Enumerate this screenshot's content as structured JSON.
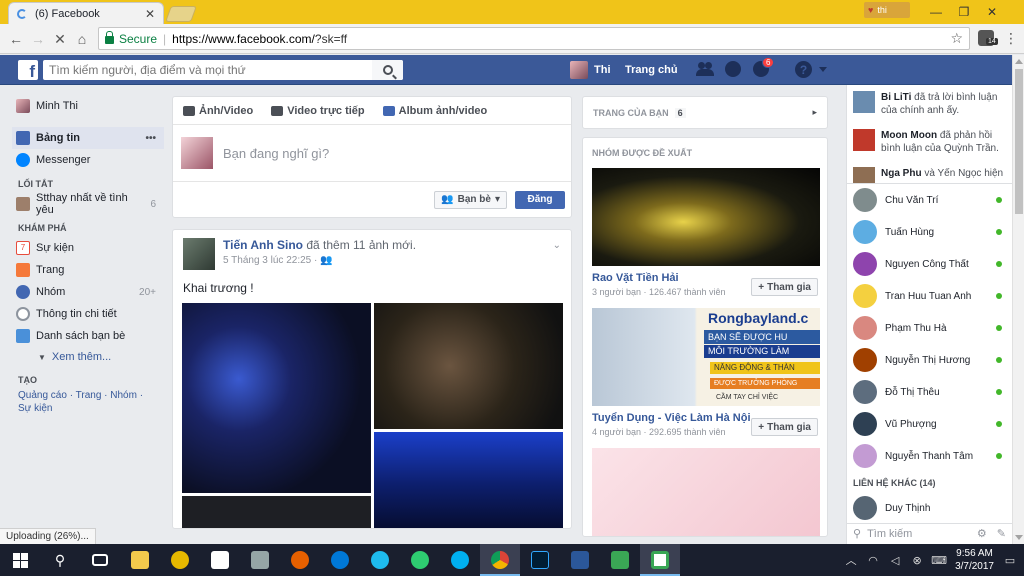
{
  "browser": {
    "tab_title": "(6) Facebook",
    "profile_label": "thi",
    "secure_label": "Secure",
    "url_base": "https://www.facebook.com/",
    "url_rest": "?sk=ff",
    "status_text": "Uploading (26%)..."
  },
  "fb": {
    "logo": "f",
    "search_placeholder": "Tìm kiếm người, địa điểm và mọi thứ",
    "user_name": "Thi",
    "home_label": "Trang chủ",
    "notif_count": "6",
    "help_glyph": "?"
  },
  "leftnav": {
    "profile": "Minh Thi",
    "items": [
      {
        "label": "Bảng tin",
        "more": "•••"
      },
      {
        "label": "Messenger"
      }
    ],
    "shortcuts_head": "LỐI TẮT",
    "shortcuts": [
      {
        "label": "Stthay nhất về tình yêu",
        "count": "6"
      }
    ],
    "explore_head": "KHÁM PHÁ",
    "explore": [
      {
        "label": "Sự kiện",
        "count": ""
      },
      {
        "label": "Trang",
        "count": ""
      },
      {
        "label": "Nhóm",
        "count": "20+"
      },
      {
        "label": "Thông tin chi tiết",
        "count": ""
      },
      {
        "label": "Danh sách bạn bè",
        "count": ""
      }
    ],
    "see_more": "Xem thêm...",
    "create_head": "TẠO",
    "create_line1": "Quảng cáo · Trang · Nhóm ·",
    "create_line2": "Sự kiện"
  },
  "composer": {
    "tab_photo": "Ảnh/Video",
    "tab_live": "Video trực tiếp",
    "tab_album": "Album ảnh/video",
    "placeholder": "Bạn đang nghĩ gì?",
    "audience": "Bạn bè",
    "post": "Đăng"
  },
  "story": {
    "author": "Tiến Anh Sino",
    "action": " đã thêm 11 ảnh mới.",
    "time": "5 Tháng 3 lúc 22:25 · ",
    "text": "Khai trương !"
  },
  "right": {
    "pages_label": "TRANG CỦA BẠN",
    "pages_count": "6",
    "groups_head": "NHÓM ĐƯỢC ĐỀ XUẤT",
    "groups": [
      {
        "name": "Rao Vặt Tiền Hải",
        "meta": "3 người bạn · 126.467 thành viên",
        "join": "Tham gia"
      },
      {
        "name": "Tuyển Dụng - Việc Làm Hà Nội",
        "meta": "4 người bạn · 292.695 thành viên",
        "join": "Tham gia"
      }
    ],
    "group2_banner": "Rongbayland.c",
    "group2_line1": "BẠN SẼ ĐƯỢC HU",
    "group2_line2": "MÔI TRƯỜNG LÀM",
    "group2_line3": "NĂNG ĐỘNG & THÀN",
    "group2_line4": "ĐƯỢC TRƯỞNG PHÒNG",
    "group2_line5": "CẦM TAY CHỈ VIỆC"
  },
  "chat": {
    "ticker": [
      {
        "name": "Bi LiTi",
        "text": " đã trả lời bình luận của chính anh ấy."
      },
      {
        "name": "Moon Moon",
        "text": " đã phản hồi bình luận của Quỳnh Trần."
      },
      {
        "name": "Nga Phu",
        "text": " và Yến Ngọc hiện"
      }
    ],
    "contacts": [
      "Chu Văn Trí",
      "Tuấn Hùng",
      "Nguyen Công Thất",
      "Tran Huu Tuan Anh",
      "Phạm Thu Hà",
      "Nguyễn Thị Hương",
      "Đỗ Thị Thêu",
      "Vũ Phượng",
      "Nguyễn Thanh Tâm"
    ],
    "other_head": "LIÊN HỆ KHÁC (14)",
    "other_first": "Duy Thịnh",
    "search_placeholder": "Tìm kiếm"
  },
  "taskbar": {
    "time": "9:56 AM",
    "date": "3/7/2017"
  },
  "colors": {
    "fb_blue": "#3b5998",
    "chrome_title": "#f0c419",
    "online": "#42b72a"
  }
}
